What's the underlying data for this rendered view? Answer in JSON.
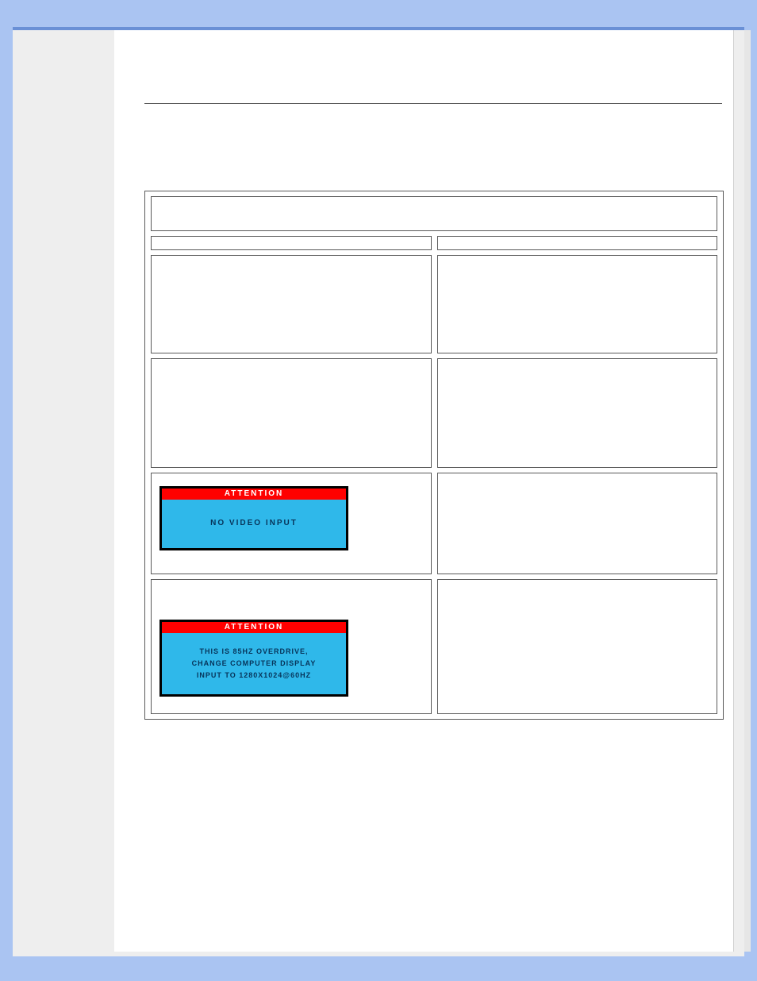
{
  "table": {
    "header_span_text": "",
    "col_left_header": "",
    "col_right_header": ""
  },
  "osd1": {
    "title": "ATTENTION",
    "message": "NO VIDEO INPUT"
  },
  "osd2": {
    "title": "ATTENTION",
    "line1": "THIS IS 85HZ OVERDRIVE,",
    "line2": "CHANGE COMPUTER DISPLAY",
    "line3": "INPUT TO 1280X1024@60HZ"
  }
}
